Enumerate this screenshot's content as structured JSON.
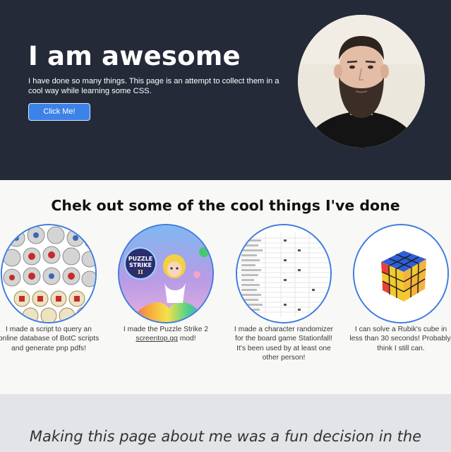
{
  "hero": {
    "title": "I am awesome",
    "text": "I have done so many things. This page is an attempt to collect them in a cool way while learning some CSS.",
    "button_label": "Click Me!",
    "colors": {
      "background": "#242a38",
      "button": "#3d82e6"
    }
  },
  "projects": {
    "title": "Chek out some of the cool things I've done",
    "cards": [
      {
        "caption": "I made a script to query an online database of BotC scripts and generate pnp pdfs!"
      },
      {
        "caption_before": "I made the Puzzle Strike 2",
        "link": "screentop.gg",
        "caption_after": "mod!"
      },
      {
        "caption": "I made a character randomizer for the board game Stationfall! It's been used by at least one other person!"
      },
      {
        "caption": "I can solve a Rubik's cube in less than 30 seconds! Probably. think I still can."
      }
    ],
    "thumb_icons": [
      "token-sheet-image",
      "puzzle-strike-art",
      "spreadsheet-image",
      "rubiks-cube-image"
    ],
    "logo_text": [
      "PUZZLE",
      "STRIKE",
      "II"
    ],
    "accent_color": "#3d7be0"
  },
  "quote": {
    "text": "Making this page about me was a fun decision in the"
  }
}
